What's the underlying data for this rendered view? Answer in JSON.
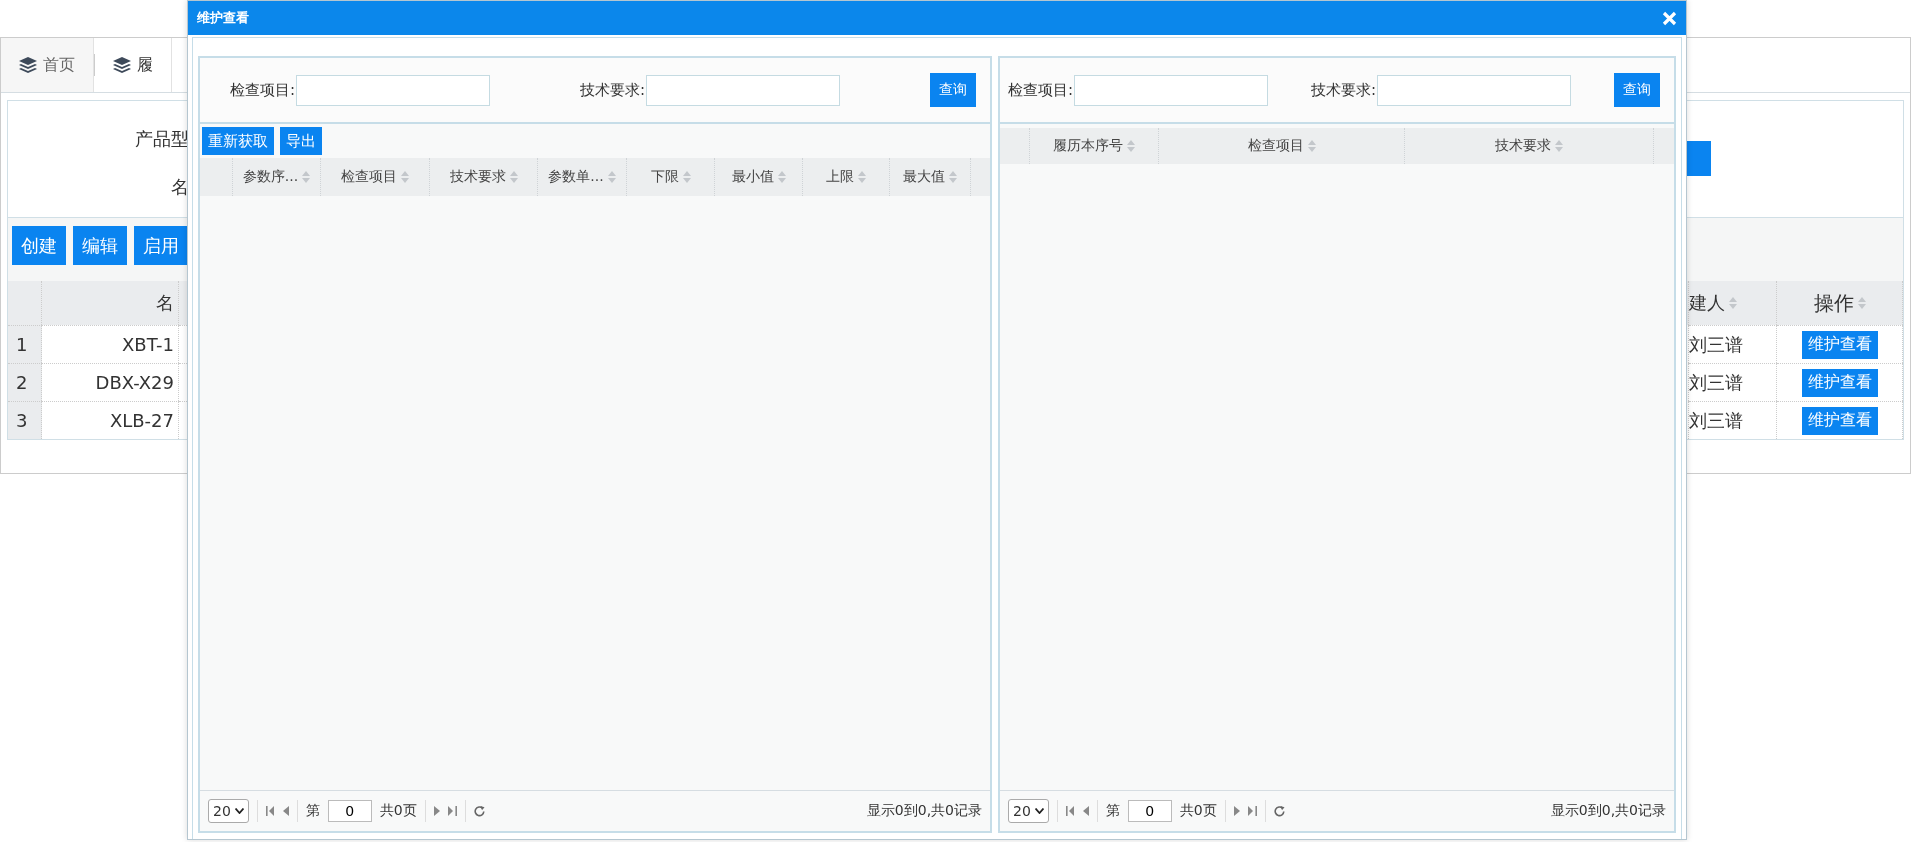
{
  "tabs": [
    {
      "label": "首页",
      "selected": false
    },
    {
      "label": "履",
      "selected": true
    }
  ],
  "filter_labels": [
    "产品型",
    "名"
  ],
  "toolbar": [
    "创建",
    "编辑",
    "启用"
  ],
  "table": {
    "columns": [
      "名",
      "建人",
      "操作"
    ],
    "rows": [
      {
        "index": "1",
        "name": "XBT-1",
        "creator": "刘三谱",
        "action": "维护查看"
      },
      {
        "index": "2",
        "name": "DBX-X29",
        "creator": "刘三谱",
        "action": "维护查看"
      },
      {
        "index": "3",
        "name": "XLB-27",
        "creator": "刘三谱",
        "action": "维护查看"
      }
    ]
  },
  "dialog": {
    "title": "维护查看",
    "panels": [
      {
        "filters": [
          {
            "label": "检查项目:"
          },
          {
            "label": "技术要求:"
          }
        ],
        "search_button": "查询",
        "toolbar": [
          "重新获取",
          "导出"
        ],
        "columns": [
          "参数序...",
          "检查项目",
          "技术要求",
          "参数单...",
          "下限",
          "最小值",
          "上限",
          "最大值"
        ],
        "pager": {
          "page_size": "20",
          "page_label": "第",
          "page": "0",
          "total_pages": "共0页",
          "summary": "显示0到0,共0记录"
        }
      },
      {
        "filters": [
          {
            "label": "检查项目:"
          },
          {
            "label": "技术要求:"
          }
        ],
        "search_button": "查询",
        "columns": [
          "履历本序号",
          "检查项目",
          "技术要求"
        ],
        "pager": {
          "page_size": "20",
          "page_label": "第",
          "page": "0",
          "total_pages": "共0页",
          "summary": "显示0到0,共0记录"
        }
      }
    ]
  }
}
